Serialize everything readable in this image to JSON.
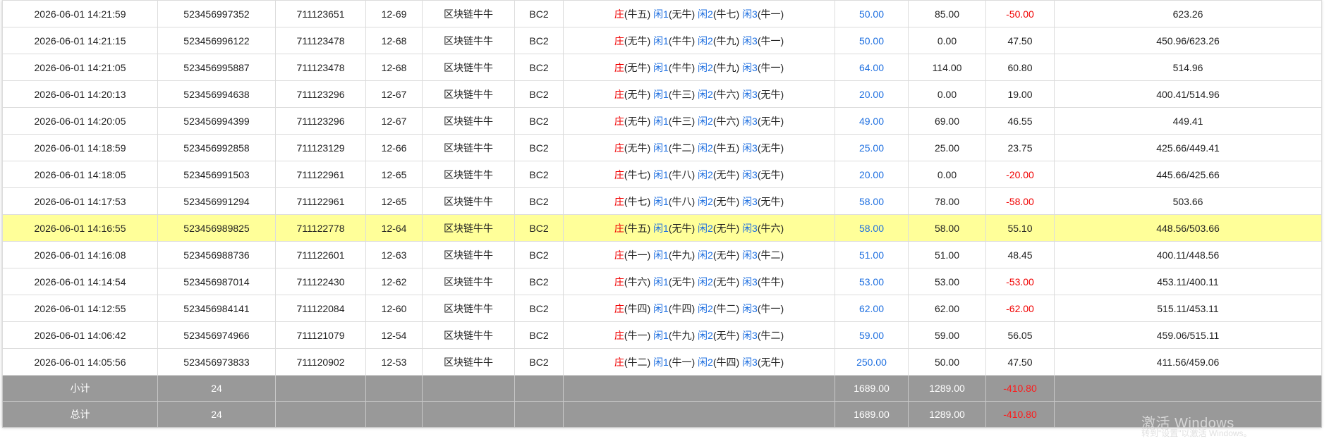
{
  "rows": [
    {
      "time": "2026-06-01 14:21:59",
      "order": "523456997352",
      "issue": "711123651",
      "round": "12-69",
      "game": "区块链牛牛",
      "table": "BC2",
      "bet": [
        {
          "k": "庄",
          "v": "(牛五)"
        },
        {
          "k": "闲1",
          "v": "(无牛)"
        },
        {
          "k": "闲2",
          "v": "(牛七)"
        },
        {
          "k": "闲3",
          "v": "(牛一)"
        }
      ],
      "amount": "50.00",
      "valid": "85.00",
      "win": "-50.00",
      "win_neg": true,
      "balance": "623.26",
      "highlight": false
    },
    {
      "time": "2026-06-01 14:21:15",
      "order": "523456996122",
      "issue": "711123478",
      "round": "12-68",
      "game": "区块链牛牛",
      "table": "BC2",
      "bet": [
        {
          "k": "庄",
          "v": "(无牛)"
        },
        {
          "k": "闲1",
          "v": "(牛牛)"
        },
        {
          "k": "闲2",
          "v": "(牛九)"
        },
        {
          "k": "闲3",
          "v": "(牛一)"
        }
      ],
      "amount": "50.00",
      "valid": "0.00",
      "win": "47.50",
      "win_neg": false,
      "balance": "450.96/623.26",
      "highlight": false
    },
    {
      "time": "2026-06-01 14:21:05",
      "order": "523456995887",
      "issue": "711123478",
      "round": "12-68",
      "game": "区块链牛牛",
      "table": "BC2",
      "bet": [
        {
          "k": "庄",
          "v": "(无牛)"
        },
        {
          "k": "闲1",
          "v": "(牛牛)"
        },
        {
          "k": "闲2",
          "v": "(牛九)"
        },
        {
          "k": "闲3",
          "v": "(牛一)"
        }
      ],
      "amount": "64.00",
      "valid": "114.00",
      "win": "60.80",
      "win_neg": false,
      "balance": "514.96",
      "highlight": false
    },
    {
      "time": "2026-06-01 14:20:13",
      "order": "523456994638",
      "issue": "711123296",
      "round": "12-67",
      "game": "区块链牛牛",
      "table": "BC2",
      "bet": [
        {
          "k": "庄",
          "v": "(无牛)"
        },
        {
          "k": "闲1",
          "v": "(牛三)"
        },
        {
          "k": "闲2",
          "v": "(牛六)"
        },
        {
          "k": "闲3",
          "v": "(无牛)"
        }
      ],
      "amount": "20.00",
      "valid": "0.00",
      "win": "19.00",
      "win_neg": false,
      "balance": "400.41/514.96",
      "highlight": false
    },
    {
      "time": "2026-06-01 14:20:05",
      "order": "523456994399",
      "issue": "711123296",
      "round": "12-67",
      "game": "区块链牛牛",
      "table": "BC2",
      "bet": [
        {
          "k": "庄",
          "v": "(无牛)"
        },
        {
          "k": "闲1",
          "v": "(牛三)"
        },
        {
          "k": "闲2",
          "v": "(牛六)"
        },
        {
          "k": "闲3",
          "v": "(无牛)"
        }
      ],
      "amount": "49.00",
      "valid": "69.00",
      "win": "46.55",
      "win_neg": false,
      "balance": "449.41",
      "highlight": false
    },
    {
      "time": "2026-06-01 14:18:59",
      "order": "523456992858",
      "issue": "711123129",
      "round": "12-66",
      "game": "区块链牛牛",
      "table": "BC2",
      "bet": [
        {
          "k": "庄",
          "v": "(无牛)"
        },
        {
          "k": "闲1",
          "v": "(牛二)"
        },
        {
          "k": "闲2",
          "v": "(牛五)"
        },
        {
          "k": "闲3",
          "v": "(无牛)"
        }
      ],
      "amount": "25.00",
      "valid": "25.00",
      "win": "23.75",
      "win_neg": false,
      "balance": "425.66/449.41",
      "highlight": false
    },
    {
      "time": "2026-06-01 14:18:05",
      "order": "523456991503",
      "issue": "711122961",
      "round": "12-65",
      "game": "区块链牛牛",
      "table": "BC2",
      "bet": [
        {
          "k": "庄",
          "v": "(牛七)"
        },
        {
          "k": "闲1",
          "v": "(牛八)"
        },
        {
          "k": "闲2",
          "v": "(无牛)"
        },
        {
          "k": "闲3",
          "v": "(无牛)"
        }
      ],
      "amount": "20.00",
      "valid": "0.00",
      "win": "-20.00",
      "win_neg": true,
      "balance": "445.66/425.66",
      "highlight": false
    },
    {
      "time": "2026-06-01 14:17:53",
      "order": "523456991294",
      "issue": "711122961",
      "round": "12-65",
      "game": "区块链牛牛",
      "table": "BC2",
      "bet": [
        {
          "k": "庄",
          "v": "(牛七)"
        },
        {
          "k": "闲1",
          "v": "(牛八)"
        },
        {
          "k": "闲2",
          "v": "(无牛)"
        },
        {
          "k": "闲3",
          "v": "(无牛)"
        }
      ],
      "amount": "58.00",
      "valid": "78.00",
      "win": "-58.00",
      "win_neg": true,
      "balance": "503.66",
      "highlight": false
    },
    {
      "time": "2026-06-01 14:16:55",
      "order": "523456989825",
      "issue": "711122778",
      "round": "12-64",
      "game": "区块链牛牛",
      "table": "BC2",
      "bet": [
        {
          "k": "庄",
          "v": "(牛五)"
        },
        {
          "k": "闲1",
          "v": "(无牛)"
        },
        {
          "k": "闲2",
          "v": "(无牛)"
        },
        {
          "k": "闲3",
          "v": "(牛六)"
        }
      ],
      "amount": "58.00",
      "valid": "58.00",
      "win": "55.10",
      "win_neg": false,
      "balance": "448.56/503.66",
      "highlight": true
    },
    {
      "time": "2026-06-01 14:16:08",
      "order": "523456988736",
      "issue": "711122601",
      "round": "12-63",
      "game": "区块链牛牛",
      "table": "BC2",
      "bet": [
        {
          "k": "庄",
          "v": "(牛一)"
        },
        {
          "k": "闲1",
          "v": "(牛九)"
        },
        {
          "k": "闲2",
          "v": "(无牛)"
        },
        {
          "k": "闲3",
          "v": "(牛二)"
        }
      ],
      "amount": "51.00",
      "valid": "51.00",
      "win": "48.45",
      "win_neg": false,
      "balance": "400.11/448.56",
      "highlight": false
    },
    {
      "time": "2026-06-01 14:14:54",
      "order": "523456987014",
      "issue": "711122430",
      "round": "12-62",
      "game": "区块链牛牛",
      "table": "BC2",
      "bet": [
        {
          "k": "庄",
          "v": "(牛六)"
        },
        {
          "k": "闲1",
          "v": "(无牛)"
        },
        {
          "k": "闲2",
          "v": "(无牛)"
        },
        {
          "k": "闲3",
          "v": "(牛牛)"
        }
      ],
      "amount": "53.00",
      "valid": "53.00",
      "win": "-53.00",
      "win_neg": true,
      "balance": "453.11/400.11",
      "highlight": false
    },
    {
      "time": "2026-06-01 14:12:55",
      "order": "523456984141",
      "issue": "711122084",
      "round": "12-60",
      "game": "区块链牛牛",
      "table": "BC2",
      "bet": [
        {
          "k": "庄",
          "v": "(牛四)"
        },
        {
          "k": "闲1",
          "v": "(牛四)"
        },
        {
          "k": "闲2",
          "v": "(牛二)"
        },
        {
          "k": "闲3",
          "v": "(牛一)"
        }
      ],
      "amount": "62.00",
      "valid": "62.00",
      "win": "-62.00",
      "win_neg": true,
      "balance": "515.11/453.11",
      "highlight": false
    },
    {
      "time": "2026-06-01 14:06:42",
      "order": "523456974966",
      "issue": "711121079",
      "round": "12-54",
      "game": "区块链牛牛",
      "table": "BC2",
      "bet": [
        {
          "k": "庄",
          "v": "(牛一)"
        },
        {
          "k": "闲1",
          "v": "(牛九)"
        },
        {
          "k": "闲2",
          "v": "(无牛)"
        },
        {
          "k": "闲3",
          "v": "(牛二)"
        }
      ],
      "amount": "59.00",
      "valid": "59.00",
      "win": "56.05",
      "win_neg": false,
      "balance": "459.06/515.11",
      "highlight": false
    },
    {
      "time": "2026-06-01 14:05:56",
      "order": "523456973833",
      "issue": "711120902",
      "round": "12-53",
      "game": "区块链牛牛",
      "table": "BC2",
      "bet": [
        {
          "k": "庄",
          "v": "(牛二)"
        },
        {
          "k": "闲1",
          "v": "(牛一)"
        },
        {
          "k": "闲2",
          "v": "(牛四)"
        },
        {
          "k": "闲3",
          "v": "(无牛)"
        }
      ],
      "amount": "250.00",
      "valid": "50.00",
      "win": "47.50",
      "win_neg": false,
      "balance": "411.56/459.06",
      "highlight": false
    }
  ],
  "subtotal": {
    "label": "小计",
    "count": "24",
    "amount": "1689.00",
    "valid": "1289.00",
    "win": "-410.80"
  },
  "total": {
    "label": "总计",
    "count": "24",
    "amount": "1689.00",
    "valid": "1289.00",
    "win": "-410.80"
  },
  "watermark": {
    "title": "激活 Windows",
    "sub": "转到\"设置\"以激活 Windows。"
  },
  "colors": {
    "bet_amount": "#1e6fe0",
    "negative": "#f00000",
    "highlight": "#ffff99",
    "summary_bg": "#999999"
  }
}
